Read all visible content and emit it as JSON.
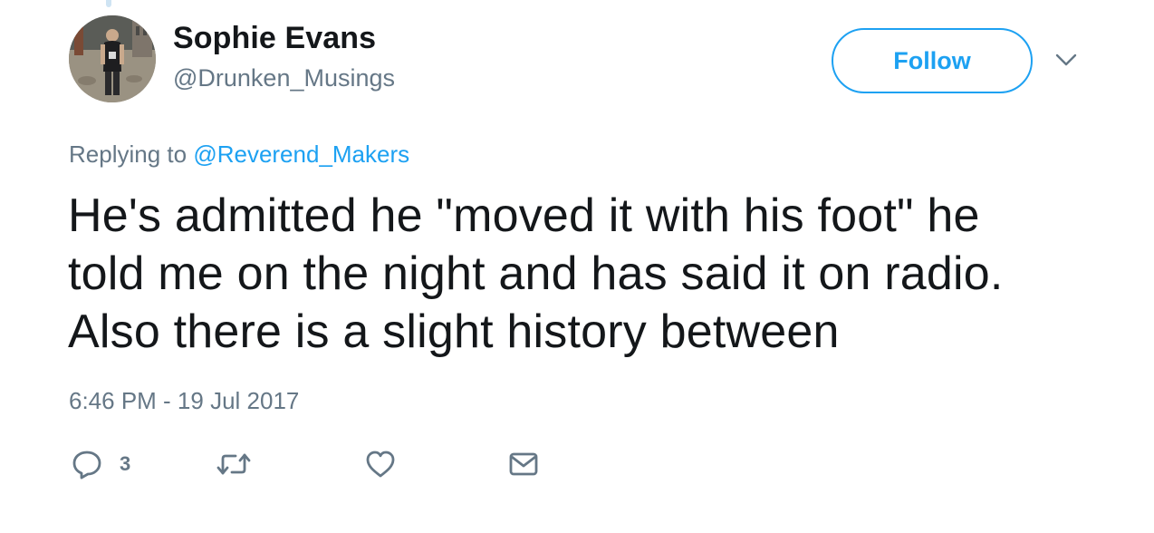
{
  "user": {
    "name": "Sophie Evans",
    "handle": "@Drunken_Musings"
  },
  "follow_button": {
    "label": "Follow"
  },
  "reply_context": {
    "prefix": "Replying to",
    "mention": "@Reverend_Makers"
  },
  "tweet": {
    "lines": [
      "He's admitted he \"moved it with his foot\" he",
      "told me on the night and has said it on radio.",
      "Also there is a slight history between"
    ],
    "timestamp": "6:46 PM - 19 Jul 2017"
  },
  "actions": {
    "reply_count": "3"
  },
  "icons": {
    "more": "chevron-down-icon",
    "reply": "reply-icon",
    "retweet": "retweet-icon",
    "like": "heart-icon",
    "message": "envelope-icon"
  },
  "colors": {
    "accent": "#1da1f2",
    "muted": "#657786",
    "text": "#14171a",
    "icon": "#657786"
  }
}
